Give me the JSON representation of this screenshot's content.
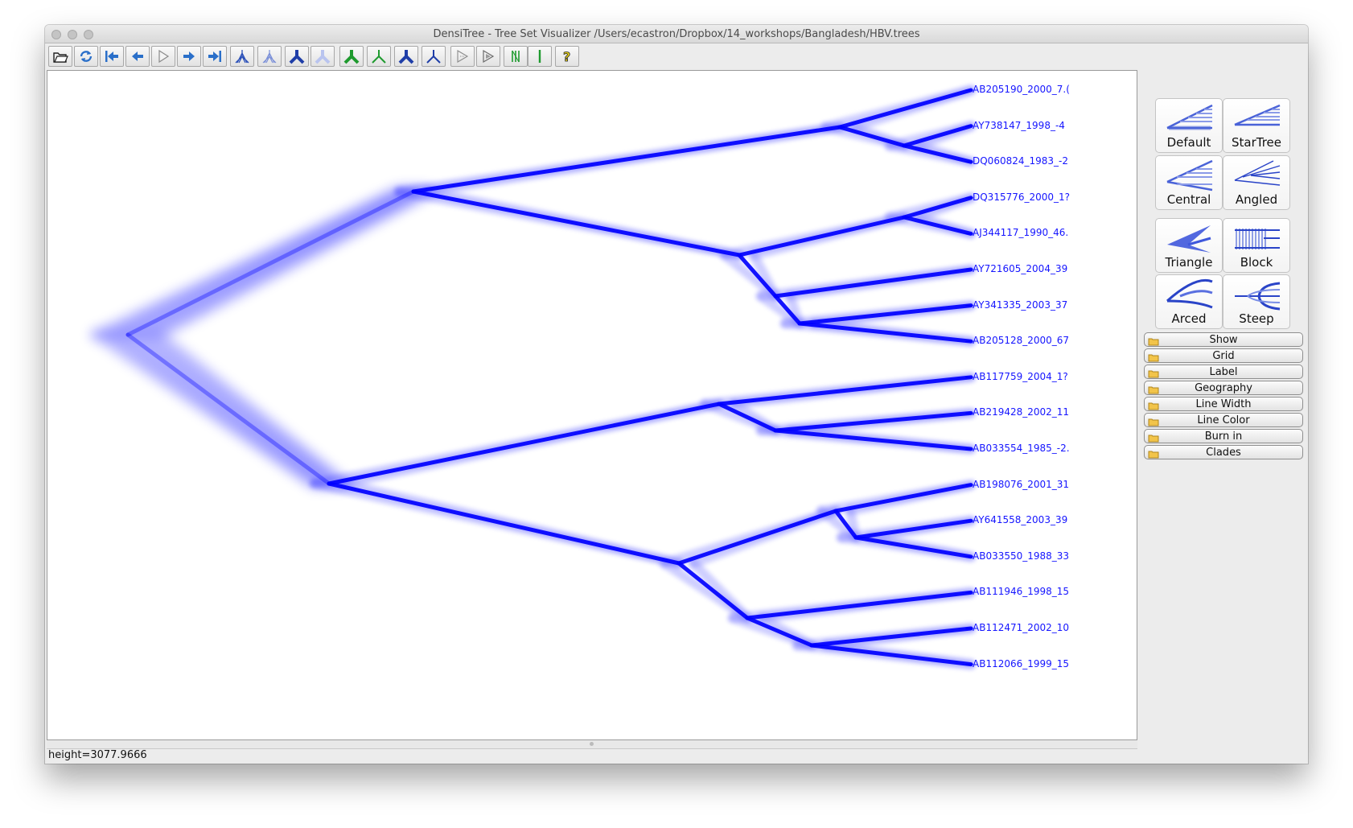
{
  "window": {
    "title": "DensiTree - Tree Set Visualizer /Users/ecastron/Dropbox/14_workshops/Bangladesh/HBV.trees"
  },
  "toolbar": {
    "buttons": [
      {
        "name": "open-icon"
      },
      {
        "name": "refresh-icon"
      },
      {
        "name": "first-icon"
      },
      {
        "name": "previous-icon"
      },
      {
        "name": "play-icon"
      },
      {
        "name": "next-icon"
      },
      {
        "name": "last-icon"
      },
      {
        "name": "tree-dense-icon"
      },
      {
        "name": "tree-light-icon"
      },
      {
        "name": "tree-bold-icon"
      },
      {
        "name": "tree-faded-icon"
      },
      {
        "name": "tree-green-bold-icon"
      },
      {
        "name": "tree-green-thin-icon"
      },
      {
        "name": "tree-blue-bold-icon"
      },
      {
        "name": "tree-blue-thin-icon"
      },
      {
        "name": "animate-icon"
      },
      {
        "name": "animate-all-icon"
      },
      {
        "name": "green-bars-icon"
      },
      {
        "name": "green-line-icon"
      },
      {
        "name": "help-icon"
      }
    ]
  },
  "tree": {
    "tips": [
      "AB205190_2000_7.(",
      "AY738147_1998_-4",
      "DQ060824_1983_-2",
      "DQ315776_2000_1?",
      "AJ344117_1990_46.",
      "AY721605_2004_39",
      "AY341335_2003_37",
      "AB205128_2000_67",
      "AB117759_2004_1?",
      "AB219428_2002_11",
      "AB033554_1985_-2.",
      "AB198076_2001_31",
      "AY641558_2003_39",
      "AB033550_1988_33",
      "AB111946_1998_15",
      "AB112471_2002_10",
      "AB112066_1999_15"
    ],
    "color": "#0000ff"
  },
  "status": {
    "text": "height=3077.9666"
  },
  "shapes": [
    {
      "label": "Default",
      "icon": "default-shape-icon"
    },
    {
      "label": "StarTree",
      "icon": "startree-shape-icon"
    },
    {
      "label": "Central",
      "icon": "central-shape-icon"
    },
    {
      "label": "Angled",
      "icon": "angled-shape-icon"
    },
    {
      "label": "Triangle",
      "icon": "triangle-shape-icon"
    },
    {
      "label": "Block",
      "icon": "block-shape-icon"
    },
    {
      "label": "Arced",
      "icon": "arced-shape-icon"
    },
    {
      "label": "Steep",
      "icon": "steep-shape-icon"
    }
  ],
  "panels": [
    "Show",
    "Grid",
    "Label",
    "Geography",
    "Line Width",
    "Line Color",
    "Burn in",
    "Clades"
  ]
}
